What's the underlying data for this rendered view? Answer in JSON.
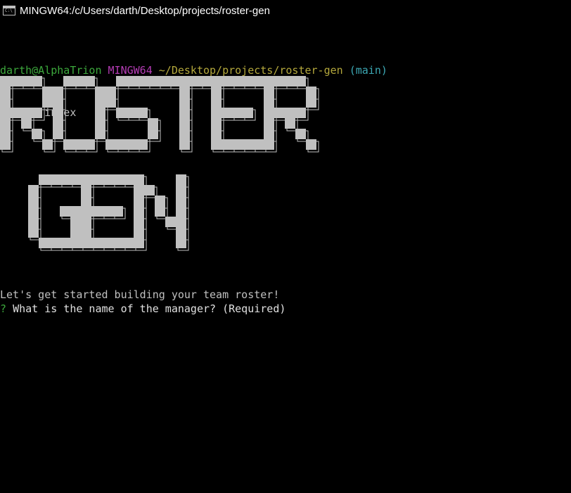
{
  "window": {
    "icon": "terminal-icon",
    "title": "MINGW64:/c/Users/darth/Desktop/projects/roster-gen"
  },
  "prompt": {
    "user_host": "darth@AlphaTrion",
    "shell": "MINGW64",
    "path": "~/Desktop/projects/roster-gen",
    "branch": "(main)",
    "symbol": "$",
    "command": "node index"
  },
  "banner": {
    "line1": "ROSTER",
    "line2": "GEN",
    "fill_color": "#c0c0c0",
    "outline_color": "#c0c0c0"
  },
  "output": {
    "welcome": "Let's get started building your team roster!",
    "question_mark": "?",
    "question": "What is the name of the manager? (Required)"
  },
  "colors": {
    "user_host": "#3ca83c",
    "shell": "#b43cb4",
    "path": "#b4a83c",
    "branch": "#3ca8b4",
    "question_mark": "#3ca83c",
    "question": "#e0e0e0",
    "background": "#000000"
  }
}
